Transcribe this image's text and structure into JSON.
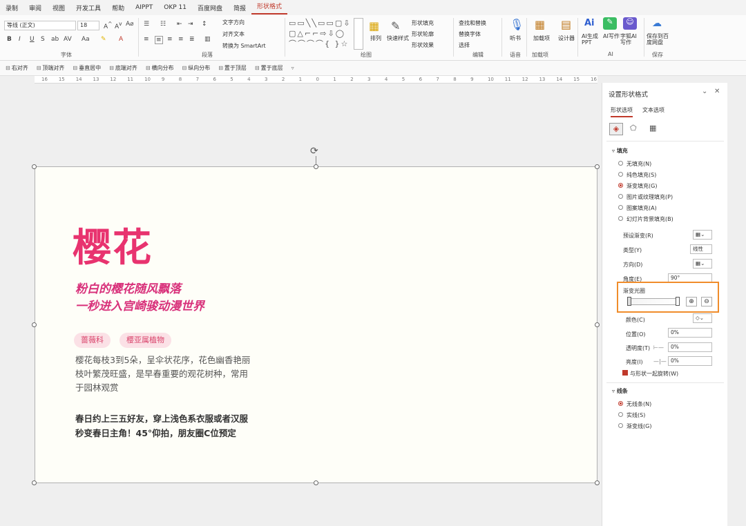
{
  "menu": [
    "录制",
    "审阅",
    "视图",
    "开发工具",
    "帮助",
    "AIPPT",
    "OKP 11",
    "百度网盘",
    "简报",
    "形状格式"
  ],
  "menu_active": "形状格式",
  "ribbon": {
    "font_name": "等线 (正文)",
    "font_size": "18",
    "groups": {
      "font": "字体",
      "paragraph": "段落",
      "drawing": "绘图",
      "edit": "编辑",
      "voice": "语音",
      "addins": "加载项",
      "ai": "AI",
      "save": "保存"
    },
    "text_direction": "文字方向",
    "align_text": "对齐文本",
    "smartart": "转换为 SmartArt",
    "arrange": "排列",
    "quick_style": "快速样式",
    "shape_fill": "形状填充",
    "shape_outline": "形状轮廓",
    "shape_effect": "形状效果",
    "find_replace": "查找和替换",
    "replace_font": "替换字体",
    "select": "选择",
    "listen": "听书",
    "addin": "加载项",
    "designer": "设计器",
    "ai_ppt": "AI生成PPT",
    "ai_write": "AI写作",
    "zifeng": "字狐AI写作",
    "save_baidu": "保存到百度网盘"
  },
  "quickbar": [
    "右对齐",
    "顶端对齐",
    "垂直居中",
    "底端对齐",
    "横向分布",
    "纵向分布",
    "置于顶层",
    "置于底层"
  ],
  "ruler": [
    "16",
    "15",
    "14",
    "13",
    "12",
    "11",
    "10",
    "9",
    "8",
    "7",
    "6",
    "5",
    "4",
    "3",
    "2",
    "1",
    "0",
    "1",
    "2",
    "3",
    "4",
    "5",
    "6",
    "7",
    "8",
    "9",
    "10",
    "11",
    "12",
    "13",
    "14",
    "15",
    "16"
  ],
  "slide": {
    "title": "樱花",
    "subtitle1": "粉白的樱花随风飘落",
    "subtitle2": "一秒进入宫崎骏动漫世界",
    "tags": [
      "蔷薇科",
      "樱亚属植物"
    ],
    "body1": "樱花每枝3到5朵，呈伞状花序，花色幽香艳丽",
    "body2": "枝叶繁茂旺盛，是早春重要的观花树种，常用",
    "body3": "于园林观赏",
    "bold1": "春日约上三五好友，穿上浅色系衣服或者汉服",
    "bold2": "秒变春日主角！45°仰拍，朋友圈C位预定"
  },
  "panel": {
    "title": "设置形状格式",
    "tab_shape": "形状选项",
    "tab_text": "文本选项",
    "fill": "填充",
    "fill_options": [
      "无填充(N)",
      "纯色填充(S)",
      "渐变填充(G)",
      "图片或纹理填充(P)",
      "图案填充(A)",
      "幻灯片背景填充(B)"
    ],
    "fill_selected": 2,
    "preset": "预设渐变(R)",
    "type": "类型(Y)",
    "type_value": "线性",
    "direction": "方向(D)",
    "angle": "角度(E)",
    "angle_value": "90°",
    "gradient_stops": "渐变光圈",
    "color": "颜色(C)",
    "position": "位置(O)",
    "position_value": "0%",
    "transparency": "透明度(T)",
    "transparency_value": "0%",
    "brightness": "亮度(I)",
    "brightness_value": "0%",
    "rotate_with_shape": "与形状一起旋转(W)",
    "line": "线条",
    "line_options": [
      "无线条(N)",
      "实线(S)",
      "渐变线(G)"
    ],
    "line_selected": 0
  }
}
